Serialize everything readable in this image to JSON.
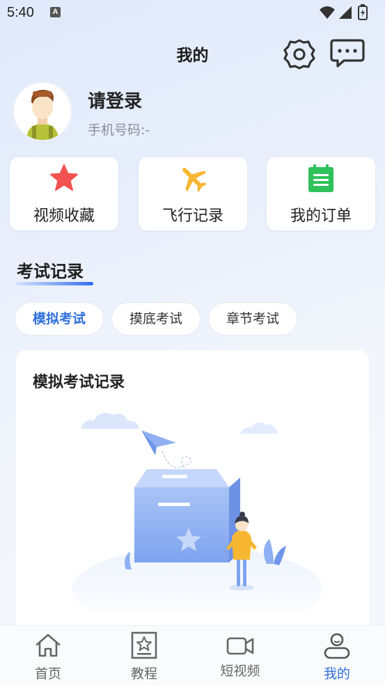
{
  "status_bar": {
    "time": "5:40",
    "notification_letter": "A"
  },
  "header": {
    "title": "我的"
  },
  "profile": {
    "login_label": "请登录",
    "phone_label": "手机号码:-"
  },
  "quick_actions": [
    {
      "label": "视频收藏",
      "icon": "star-icon",
      "color": "#f45151"
    },
    {
      "label": "飞行记录",
      "icon": "airplane-icon",
      "color": "#f7b733"
    },
    {
      "label": "我的订单",
      "icon": "clipboard-icon",
      "color": "#2fc25b"
    }
  ],
  "exam_section": {
    "title": "考试记录",
    "tabs": [
      {
        "label": "模拟考试",
        "active": true
      },
      {
        "label": "摸底考试",
        "active": false
      },
      {
        "label": "章节考试",
        "active": false
      }
    ],
    "record_title": "模拟考试记录"
  },
  "bottom_nav": [
    {
      "label": "首页",
      "icon": "home-icon",
      "active": false
    },
    {
      "label": "教程",
      "icon": "tutorial-icon",
      "active": false
    },
    {
      "label": "短视频",
      "icon": "video-camera-icon",
      "active": false
    },
    {
      "label": "我的",
      "icon": "user-icon",
      "active": true
    }
  ],
  "colors": {
    "accent": "#2f6fdb",
    "star": "#f45151",
    "plane": "#f7b733",
    "order": "#2fc25b"
  }
}
